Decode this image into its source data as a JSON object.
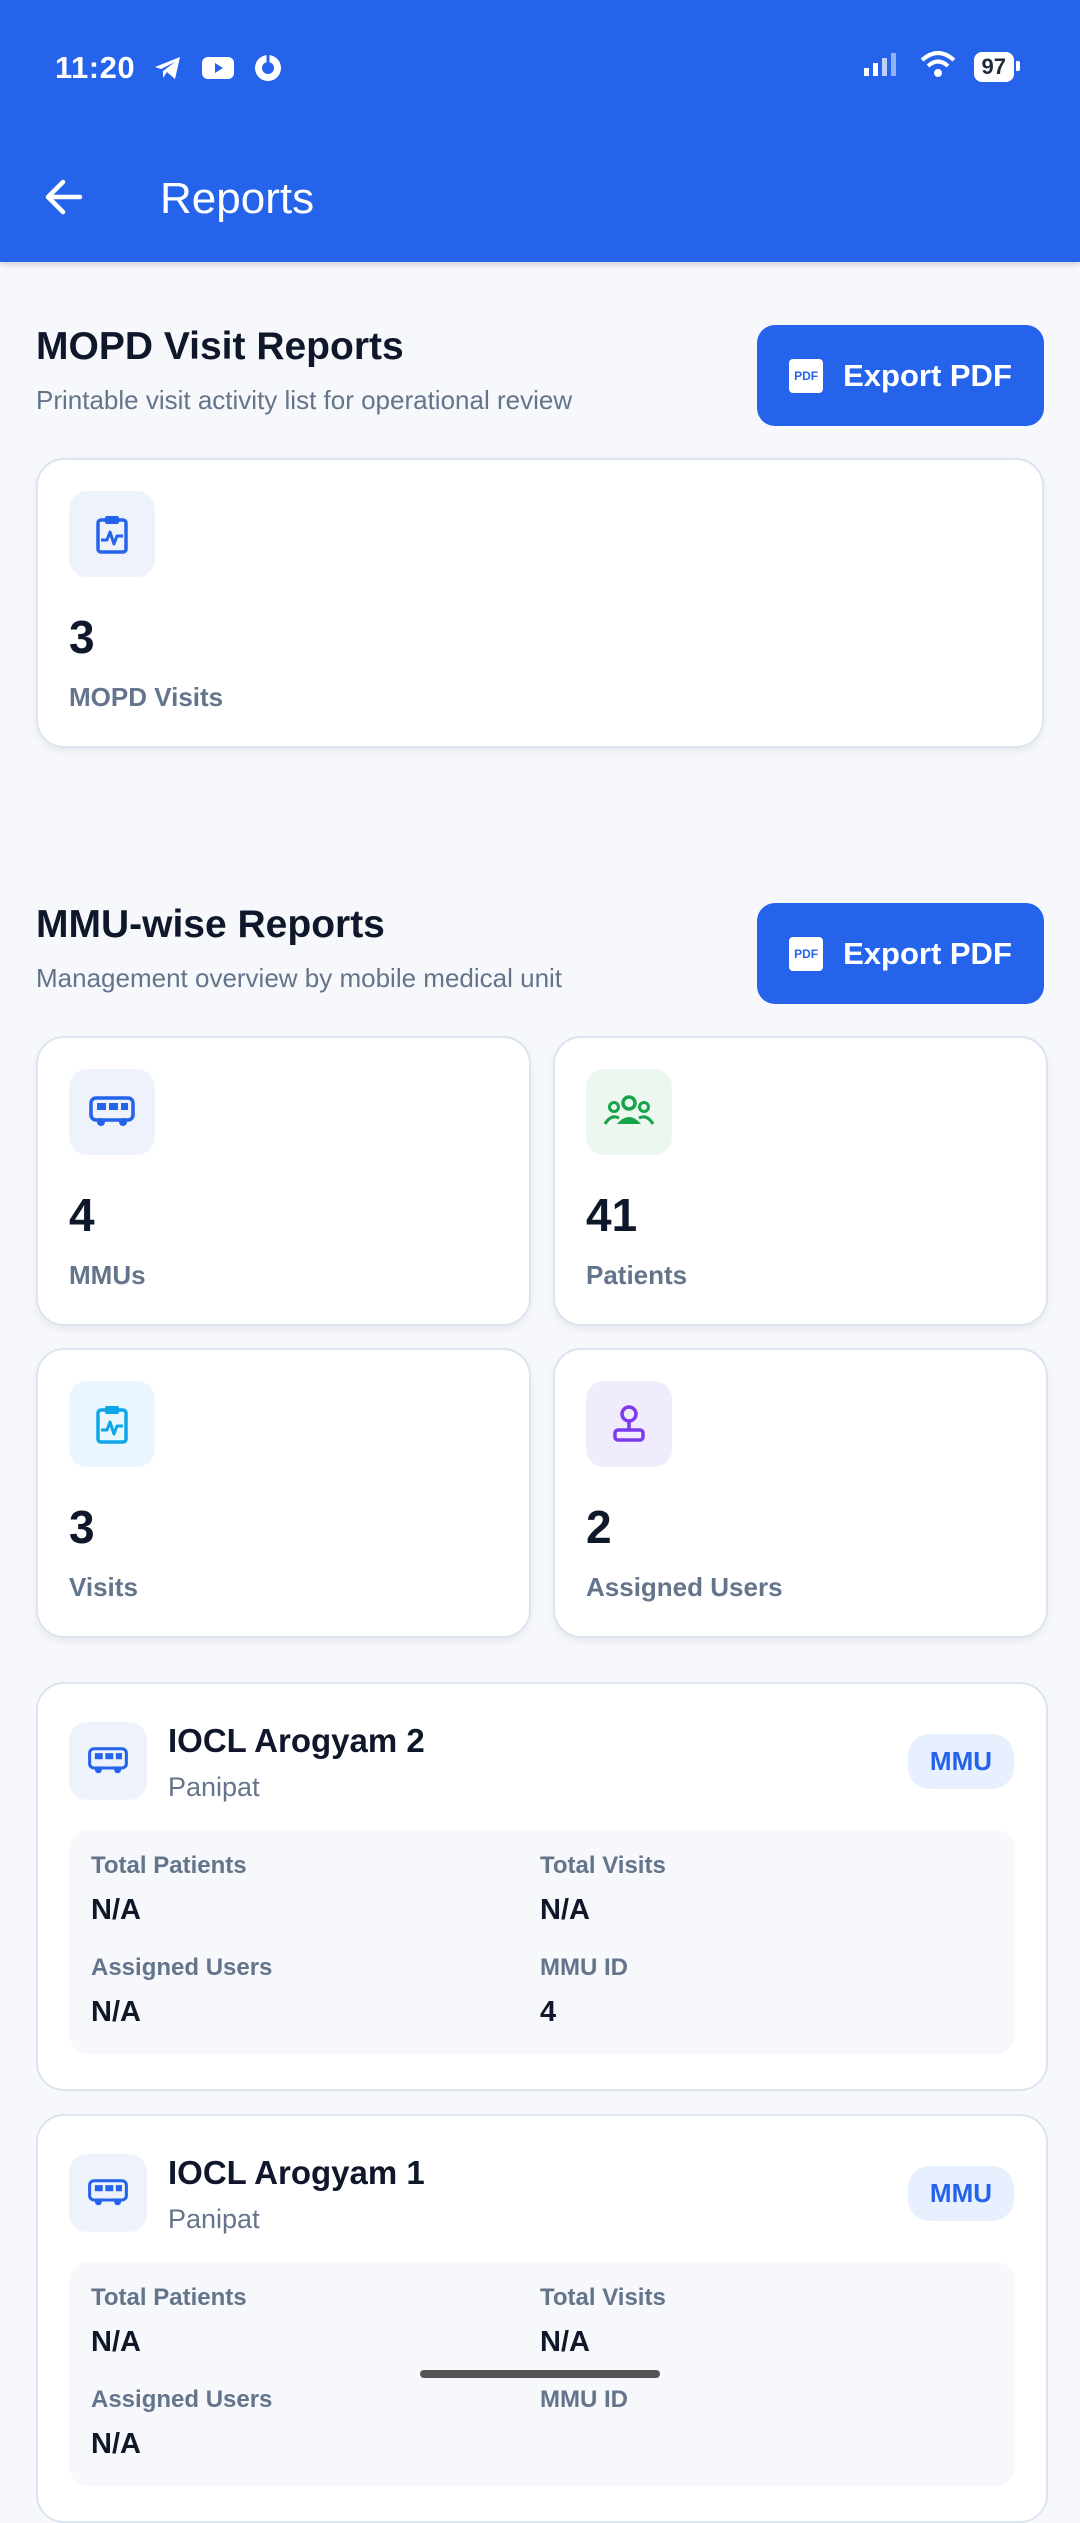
{
  "status_bar": {
    "time": "11:20",
    "battery": "97"
  },
  "app_bar": {
    "title": "Reports"
  },
  "mopd": {
    "title": "MOPD Visit Reports",
    "subtitle": "Printable visit activity list for operational review",
    "export_label": "Export PDF",
    "stat": {
      "value": "3",
      "label": "MOPD Visits",
      "icon": "clipboard-pulse-icon"
    }
  },
  "mmu": {
    "title": "MMU-wise Reports",
    "subtitle": "Management overview by mobile medical unit",
    "export_label": "Export PDF",
    "stats": [
      {
        "value": "4",
        "label": "MMUs",
        "icon": "bus-icon",
        "color": "#2563eb",
        "bg": "#eef3fb"
      },
      {
        "value": "41",
        "label": "Patients",
        "icon": "group-icon",
        "color": "#16a34a",
        "bg": "#ecf7ef"
      },
      {
        "value": "3",
        "label": "Visits",
        "icon": "clipboard-pulse-icon",
        "color": "#0ea5e9",
        "bg": "#eaf6fd"
      },
      {
        "value": "2",
        "label": "Assigned Users",
        "icon": "user-badge-icon",
        "color": "#7c3aed",
        "bg": "#f1ecfd"
      }
    ]
  },
  "units": [
    {
      "name": "IOCL Arogyam 2",
      "location": "Panipat",
      "badge": "MMU",
      "fields": {
        "total_patients_label": "Total Patients",
        "total_patients": "N/A",
        "total_visits_label": "Total Visits",
        "total_visits": "N/A",
        "assigned_users_label": "Assigned Users",
        "assigned_users": "N/A",
        "mmu_id_label": "MMU ID",
        "mmu_id": "4"
      }
    },
    {
      "name": "IOCL Arogyam 1",
      "location": "Panipat",
      "badge": "MMU",
      "fields": {
        "total_patients_label": "Total Patients",
        "total_patients": "N/A",
        "total_visits_label": "Total Visits",
        "total_visits": "N/A",
        "assigned_users_label": "Assigned Users",
        "assigned_users": "N/A",
        "mmu_id_label": "MMU ID",
        "mmu_id": ""
      }
    }
  ]
}
